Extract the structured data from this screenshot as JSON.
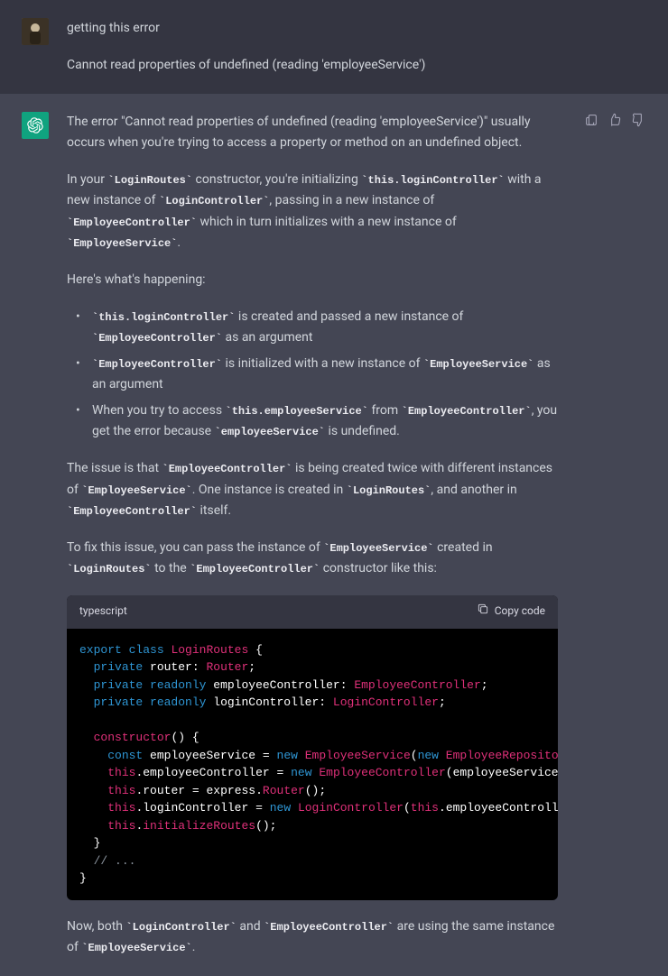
{
  "user": {
    "line1": "getting this error",
    "line2": "Cannot read properties of undefined (reading 'employeeService')"
  },
  "assistant": {
    "p1_a": "The error \"Cannot read properties of undefined (reading 'employeeService')\" usually occurs when you're trying to access a property or method on an undefined object.",
    "p2_1": "In your ",
    "p2_c1": "`LoginRoutes`",
    "p2_2": " constructor, you're initializing ",
    "p2_c2": "`this.loginController`",
    "p2_3": " with a new instance of ",
    "p2_c3": "`LoginController`",
    "p2_4": ", passing in a new instance of ",
    "p2_c4": "`EmployeeController`",
    "p2_5": " which in turn initializes with a new instance of ",
    "p2_c5": "`EmployeeService`",
    "p2_6": ".",
    "p3": "Here's what's happening:",
    "li1_c1": "`this.loginController`",
    "li1_t1": " is created and passed a new instance of ",
    "li1_c2": "`EmployeeController`",
    "li1_t2": " as an argument",
    "li2_c1": "`EmployeeController`",
    "li2_t1": " is initialized with a new instance of ",
    "li2_c2": "`EmployeeService`",
    "li2_t2": " as an argument",
    "li3_t1": "When you try to access ",
    "li3_c1": "`this.employeeService`",
    "li3_t2": " from ",
    "li3_c2": "`EmployeeController`",
    "li3_t3": ", you get the error because ",
    "li3_c3": "`employeeService`",
    "li3_t4": " is undefined.",
    "p4_1": "The issue is that ",
    "p4_c1": "`EmployeeController`",
    "p4_2": " is being created twice with different instances of ",
    "p4_c2": "`EmployeeService`",
    "p4_3": ". One instance is created in ",
    "p4_c3": "`LoginRoutes`",
    "p4_4": ", and another in ",
    "p4_c4": "`EmployeeController`",
    "p4_5": " itself.",
    "p5_1": "To fix this issue, you can pass the instance of ",
    "p5_c1": "`EmployeeService`",
    "p5_2": " created in ",
    "p5_c2": "`LoginRoutes`",
    "p5_3": " to the ",
    "p5_c3": "`EmployeeController`",
    "p5_4": " constructor like this:",
    "code_lang": "typescript",
    "copy_label": "Copy code",
    "code_lines": [
      [
        [
          "kw",
          "export"
        ],
        [
          "sp",
          " "
        ],
        [
          "kw",
          "class"
        ],
        [
          "sp",
          " "
        ],
        [
          "cls",
          "LoginRoutes"
        ],
        [
          "sp",
          " "
        ],
        [
          "punc",
          "{"
        ]
      ],
      [
        [
          "sp",
          "  "
        ],
        [
          "kw",
          "private"
        ],
        [
          "sp",
          " "
        ],
        [
          "id",
          "router"
        ],
        [
          "punc",
          ":"
        ],
        [
          "sp",
          " "
        ],
        [
          "type",
          "Router"
        ],
        [
          "punc",
          ";"
        ]
      ],
      [
        [
          "sp",
          "  "
        ],
        [
          "kw",
          "private"
        ],
        [
          "sp",
          " "
        ],
        [
          "kw",
          "readonly"
        ],
        [
          "sp",
          " "
        ],
        [
          "id",
          "employeeController"
        ],
        [
          "punc",
          ":"
        ],
        [
          "sp",
          " "
        ],
        [
          "type",
          "EmployeeController"
        ],
        [
          "punc",
          ";"
        ]
      ],
      [
        [
          "sp",
          "  "
        ],
        [
          "kw",
          "private"
        ],
        [
          "sp",
          " "
        ],
        [
          "kw",
          "readonly"
        ],
        [
          "sp",
          " "
        ],
        [
          "id",
          "loginController"
        ],
        [
          "punc",
          ":"
        ],
        [
          "sp",
          " "
        ],
        [
          "type",
          "LoginController"
        ],
        [
          "punc",
          ";"
        ]
      ],
      [],
      [
        [
          "sp",
          "  "
        ],
        [
          "cls",
          "constructor"
        ],
        [
          "punc",
          "()"
        ],
        [
          "sp",
          " "
        ],
        [
          "punc",
          "{"
        ]
      ],
      [
        [
          "sp",
          "    "
        ],
        [
          "kw",
          "const"
        ],
        [
          "sp",
          " "
        ],
        [
          "id",
          "employeeService"
        ],
        [
          "sp",
          " "
        ],
        [
          "punc",
          "="
        ],
        [
          "sp",
          " "
        ],
        [
          "new",
          "new"
        ],
        [
          "sp",
          " "
        ],
        [
          "type",
          "EmployeeService"
        ],
        [
          "punc",
          "("
        ],
        [
          "new",
          "new"
        ],
        [
          "sp",
          " "
        ],
        [
          "type",
          "EmployeeRepository"
        ],
        [
          "punc",
          "());"
        ]
      ],
      [
        [
          "sp",
          "    "
        ],
        [
          "this",
          "this"
        ],
        [
          "punc",
          "."
        ],
        [
          "id",
          "employeeController"
        ],
        [
          "sp",
          " "
        ],
        [
          "punc",
          "="
        ],
        [
          "sp",
          " "
        ],
        [
          "new",
          "new"
        ],
        [
          "sp",
          " "
        ],
        [
          "type",
          "EmployeeController"
        ],
        [
          "punc",
          "("
        ],
        [
          "id",
          "employeeService"
        ],
        [
          "punc",
          ");"
        ]
      ],
      [
        [
          "sp",
          "    "
        ],
        [
          "this",
          "this"
        ],
        [
          "punc",
          "."
        ],
        [
          "id",
          "router"
        ],
        [
          "sp",
          " "
        ],
        [
          "punc",
          "="
        ],
        [
          "sp",
          " "
        ],
        [
          "id",
          "express"
        ],
        [
          "punc",
          "."
        ],
        [
          "type",
          "Router"
        ],
        [
          "punc",
          "();"
        ]
      ],
      [
        [
          "sp",
          "    "
        ],
        [
          "this",
          "this"
        ],
        [
          "punc",
          "."
        ],
        [
          "id",
          "loginController"
        ],
        [
          "sp",
          " "
        ],
        [
          "punc",
          "="
        ],
        [
          "sp",
          " "
        ],
        [
          "new",
          "new"
        ],
        [
          "sp",
          " "
        ],
        [
          "type",
          "LoginController"
        ],
        [
          "punc",
          "("
        ],
        [
          "this",
          "this"
        ],
        [
          "punc",
          "."
        ],
        [
          "id",
          "employeeController"
        ],
        [
          "punc",
          ");"
        ]
      ],
      [
        [
          "sp",
          "    "
        ],
        [
          "this",
          "this"
        ],
        [
          "punc",
          "."
        ],
        [
          "method",
          "initializeRoutes"
        ],
        [
          "punc",
          "();"
        ]
      ],
      [
        [
          "sp",
          "  "
        ],
        [
          "punc",
          "}"
        ]
      ],
      [
        [
          "sp",
          "  "
        ],
        [
          "cmt",
          "// ..."
        ]
      ],
      [
        [
          "punc",
          "}"
        ]
      ]
    ],
    "p6_1": "Now, both ",
    "p6_c1": "`LoginController`",
    "p6_2": " and ",
    "p6_c2": "`EmployeeController`",
    "p6_3": " are using the same instance of ",
    "p6_c3": "`EmployeeService`",
    "p6_4": "."
  }
}
